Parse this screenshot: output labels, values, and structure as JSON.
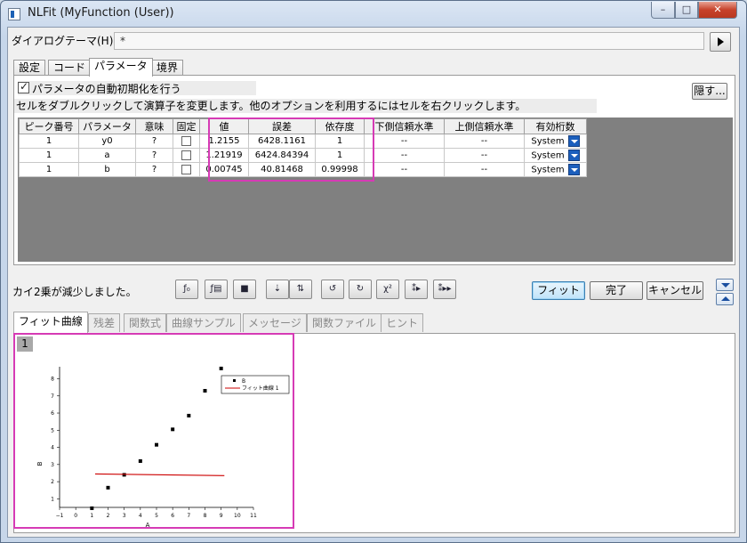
{
  "window": {
    "title": "NLFit (MyFunction (User))",
    "minimize": "–",
    "maximize": "□",
    "close": "✕"
  },
  "theme": {
    "label": "ダイアログテーマ(H)",
    "value": "*"
  },
  "top_tabs": [
    "設定",
    "コード",
    "パラメータ",
    "境界"
  ],
  "active_top_tab": "パラメータ",
  "auto_init": {
    "label": "パラメータの自動初期化を行う",
    "checked": true
  },
  "hide_button": "隠す...",
  "hint": "セルをダブルクリックして演算子を変更します。他のオプションを利用するにはセルを右クリックします。",
  "table": {
    "headers": [
      "ピーク番号",
      "パラメータ",
      "意味",
      "固定",
      "値",
      "誤差",
      "依存度",
      "下側信頼水準",
      "上側信頼水準",
      "有効桁数"
    ],
    "rows": [
      {
        "peak": "1",
        "param": "y0",
        "meaning": "?",
        "value": "1.2155",
        "error": "6428.1161",
        "dependency": "1",
        "lcl": "--",
        "ucl": "--",
        "sig": "System"
      },
      {
        "peak": "1",
        "param": "a",
        "meaning": "?",
        "value": "1.21919",
        "error": "6424.84394",
        "dependency": "1",
        "lcl": "--",
        "ucl": "--",
        "sig": "System"
      },
      {
        "peak": "1",
        "param": "b",
        "meaning": "?",
        "value": "0.00745",
        "error": "40.81468",
        "dependency": "0.99998",
        "lcl": "--",
        "ucl": "--",
        "sig": "System"
      }
    ]
  },
  "status": "カイ2乗が減少しました。",
  "toolbar": {
    "chi2_label": "χ²"
  },
  "buttons": {
    "fit": "フィット",
    "done": "完了",
    "cancel": "キャンセル"
  },
  "bottom_tabs": [
    "フィット曲線",
    "残差",
    "関数式",
    "曲線サンプル",
    "メッセージ",
    "関数ファイル",
    "ヒント"
  ],
  "active_bottom_tab": "フィット曲線",
  "layer_number": "1",
  "chart_data": {
    "type": "scatter",
    "xlabel": "A",
    "ylabel": "B",
    "xlim": [
      -1,
      11
    ],
    "ylim": [
      0.5,
      8.7
    ],
    "x_ticks": [
      "−1",
      "0",
      "1",
      "2",
      "3",
      "4",
      "5",
      "6",
      "7",
      "8",
      "9",
      "10",
      "11"
    ],
    "y_ticks": [
      "1",
      "2",
      "3",
      "4",
      "5",
      "6",
      "7",
      "8"
    ],
    "legend_placement": "top-right",
    "series": [
      {
        "name": "B",
        "kind": "points",
        "color": "#000000",
        "x": [
          1,
          2,
          3,
          4,
          5,
          6,
          7,
          8,
          9
        ],
        "y": [
          0.45,
          1.65,
          2.4,
          3.2,
          4.15,
          5.05,
          5.85,
          7.3,
          8.6
        ]
      },
      {
        "name": "フィット曲線 1",
        "kind": "line",
        "color": "#cc0000",
        "x": [
          1.2,
          9.2
        ],
        "y": [
          2.45,
          2.35
        ]
      }
    ]
  }
}
